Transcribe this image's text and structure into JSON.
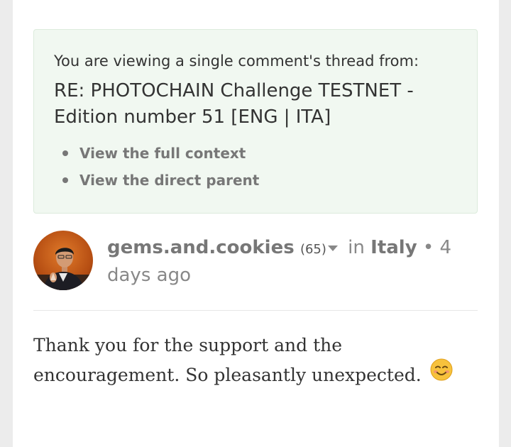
{
  "thread_context": {
    "intro": "You are viewing a single comment's thread from:",
    "title": "RE: PHOTOCHAIN Challenge TESTNET - Edition number 51 [ENG | ITA]",
    "links": [
      {
        "label": "View the full context"
      },
      {
        "label": "View the direct parent"
      }
    ]
  },
  "comment": {
    "author": "gems.and.cookies",
    "reputation": "(65)",
    "in_label": "in",
    "community": "Italy",
    "separator": "•",
    "timestamp": "4 days ago",
    "body": "Thank you for the support and the encouragement. So pleasantly unexpected.",
    "emoji": "smiling-face-icon"
  },
  "colors": {
    "thread_box_bg": "#f1f8f1",
    "link_gray": "#777777",
    "text": "#333333"
  }
}
